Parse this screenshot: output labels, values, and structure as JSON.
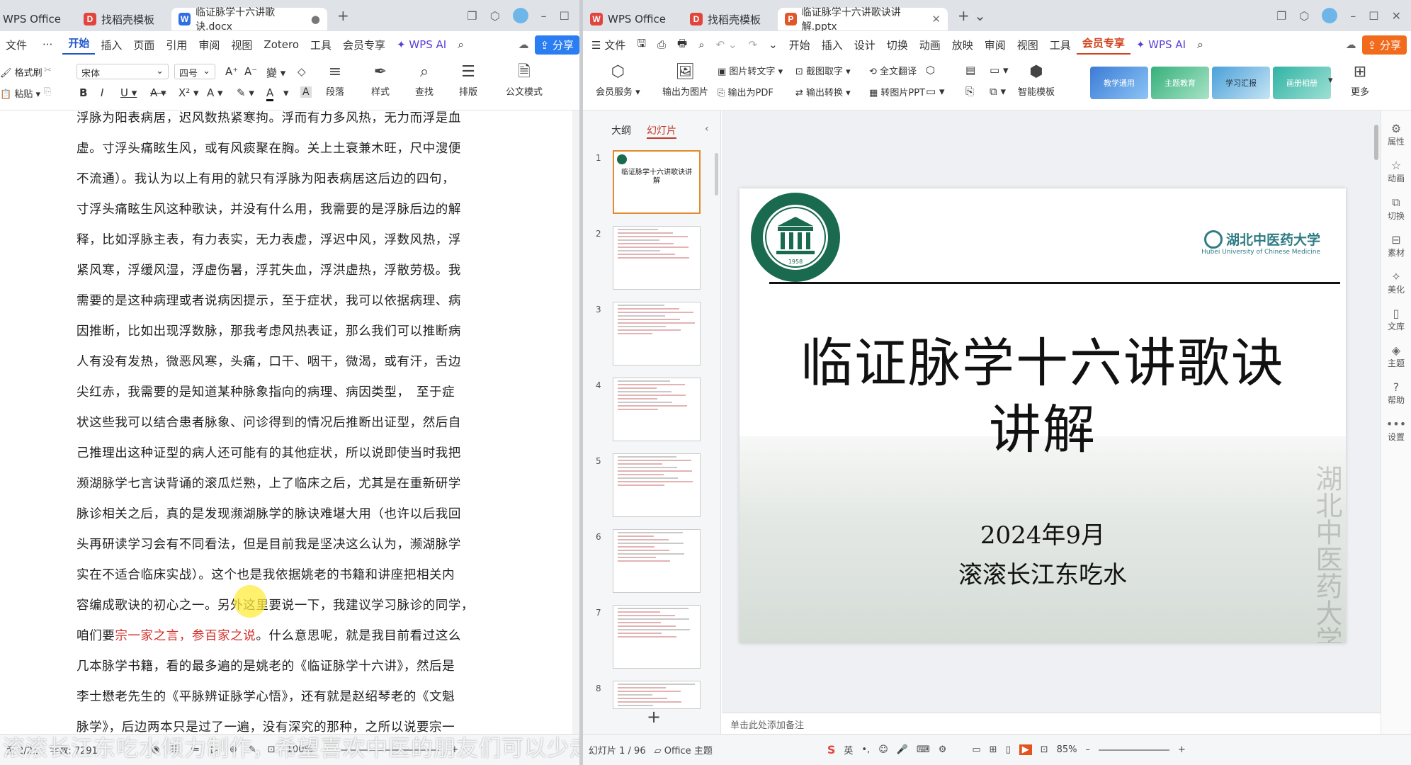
{
  "left": {
    "tabs": [
      {
        "label": "WPS Office"
      },
      {
        "label": "找稻壳模板"
      },
      {
        "label": "临证脉学十六讲歌诀.docx"
      }
    ],
    "menu": [
      "文件",
      "···",
      "开始",
      "插入",
      "页面",
      "引用",
      "审阅",
      "视图",
      "Zotero",
      "工具",
      "会员专享",
      "WPS AI"
    ],
    "share_label": "分享",
    "ribbon": {
      "format_painter": "格式刷",
      "paste": "粘贴",
      "font_name": "宋体",
      "font_size": "四号",
      "paragraph": "段落",
      "styles": "样式",
      "find": "查找",
      "layout": "排版",
      "official_mode": "公文模式"
    },
    "doc_lines": [
      "浮脉为阳表病居，迟风数热紧寒拘。浮而有力多风热，无力而浮是血",
      "虚。寸浮头痛眩生风，或有风痰聚在胸。关上土衰兼木旺，尺中溲便",
      "不流通）。我认为以上有用的就只有浮脉为阳表病居这后边的四句，",
      "寸浮头痛眩生风这种歌诀，并没有什么用，我需要的是浮脉后边的解",
      "释，比如浮脉主表，有力表实，无力表虚，浮迟中风，浮数风热，浮",
      "紧风寒，浮缓风湿，浮虚伤暑，浮芤失血，浮洪虚热，浮散劳极。我",
      "需要的是这种病理或者说病因提示，至于症状，我可以依据病理、病",
      "因推断，比如出现浮数脉，那我考虑风热表证，那么我们可以推断病",
      "人有没有发热，微恶风寒，头痛，口干、咽干，微渴，或有汗，舌边",
      "尖红赤，我需要的是知道某种脉象指向的病理、病因类型，　至于症",
      "状这些我可以结合患者脉象、问诊得到的情况后推断出证型，然后自",
      "己推理出这种证型的病人还可能有的其他症状，所以说即使当时我把",
      "濒湖脉学七言诀背诵的滚瓜烂熟，上了临床之后，尤其是在重新研学",
      "脉诊相关之后，真的是发现濒湖脉学的脉诀难堪大用（也许以后我回",
      "头再研读学习会有不同看法，但是目前我是坚决这么认为，濒湖脉学",
      "实在不适合临床实战）。这个也是我依据姚老的书籍和讲座把相关内",
      "容编成歌诀的初心之一。另外这里要说一下，我建议学习脉诊的同学，"
    ],
    "line_quote_pre": "咱们要",
    "line_quote_red": "宗一家之言，参百家之说",
    "line_quote_post": "。什么意思呢，就是我目前看过这么",
    "doc_lines_tail": [
      "几本脉学书籍，看的最多遍的是姚老的《临证脉学十六讲》，然后是",
      "李士懋老先生的《平脉辨证脉学心悟》，还有就是赵绍琴老的《文魁",
      "脉学》，后边两本只是过了一遍，没有深究的那种，之所以说要宗一"
    ],
    "status": {
      "page": "页 2/21",
      "words": "字数: 7291",
      "zoom": "100%"
    },
    "watermark": "滚滚长江东吃水倾力制作，希望喜欢中医的朋友们可以少走弯路"
  },
  "right": {
    "tabs": [
      {
        "label": "WPS Office"
      },
      {
        "label": "找稻壳模板"
      },
      {
        "label": "临证脉学十六讲歌诀讲解.pptx"
      }
    ],
    "menu": [
      "文件",
      "开始",
      "插入",
      "设计",
      "切换",
      "动画",
      "放映",
      "审阅",
      "视图",
      "工具",
      "会员专享",
      "WPS AI"
    ],
    "share_label": "分享",
    "ribbon": {
      "member_service": "会员服务",
      "export_image": "输出为图片",
      "image_to_text": "图片转文字",
      "export_pdf": "输出为PDF",
      "screenshot_ocr": "截图取字",
      "export_convert": "输出转换",
      "full_translate": "全文翻译",
      "image_to_ppt": "转图片PPT",
      "smart_template": "智能模板",
      "more": "更多",
      "theme_cards": [
        "教学通用",
        "主题教育",
        "学习汇报",
        "画册相册"
      ]
    },
    "panel_tabs": [
      "大纲",
      "幻灯片"
    ],
    "slide_numbers": [
      "1",
      "2",
      "3",
      "4",
      "5",
      "6",
      "7",
      "8"
    ],
    "slide": {
      "university_cn": "湖北中医药大学",
      "university_en": "Hubei University of Chinese Medicine",
      "seal_year": "1958",
      "title_line1": "临证脉学十六讲歌诀",
      "title_line2": "讲解",
      "date": "2024年9月",
      "author": "滚滚长江东吃水"
    },
    "thumb_title": "临证脉学十六讲歌诀讲解",
    "notes_placeholder": "单击此处添加备注",
    "side_tools": [
      "属性",
      "动画",
      "切换",
      "素材",
      "美化",
      "文库",
      "主题",
      "帮助",
      "设置"
    ],
    "status": {
      "slide": "幻灯片 1 / 96",
      "theme": "Office 主题",
      "zoom": "85%",
      "ime": "英"
    }
  },
  "colors": {
    "accent_blue": "#1f56c9",
    "red_text": "#d4302b",
    "share_orange": "#f26b1d",
    "seal_green": "#1a6a4f"
  }
}
